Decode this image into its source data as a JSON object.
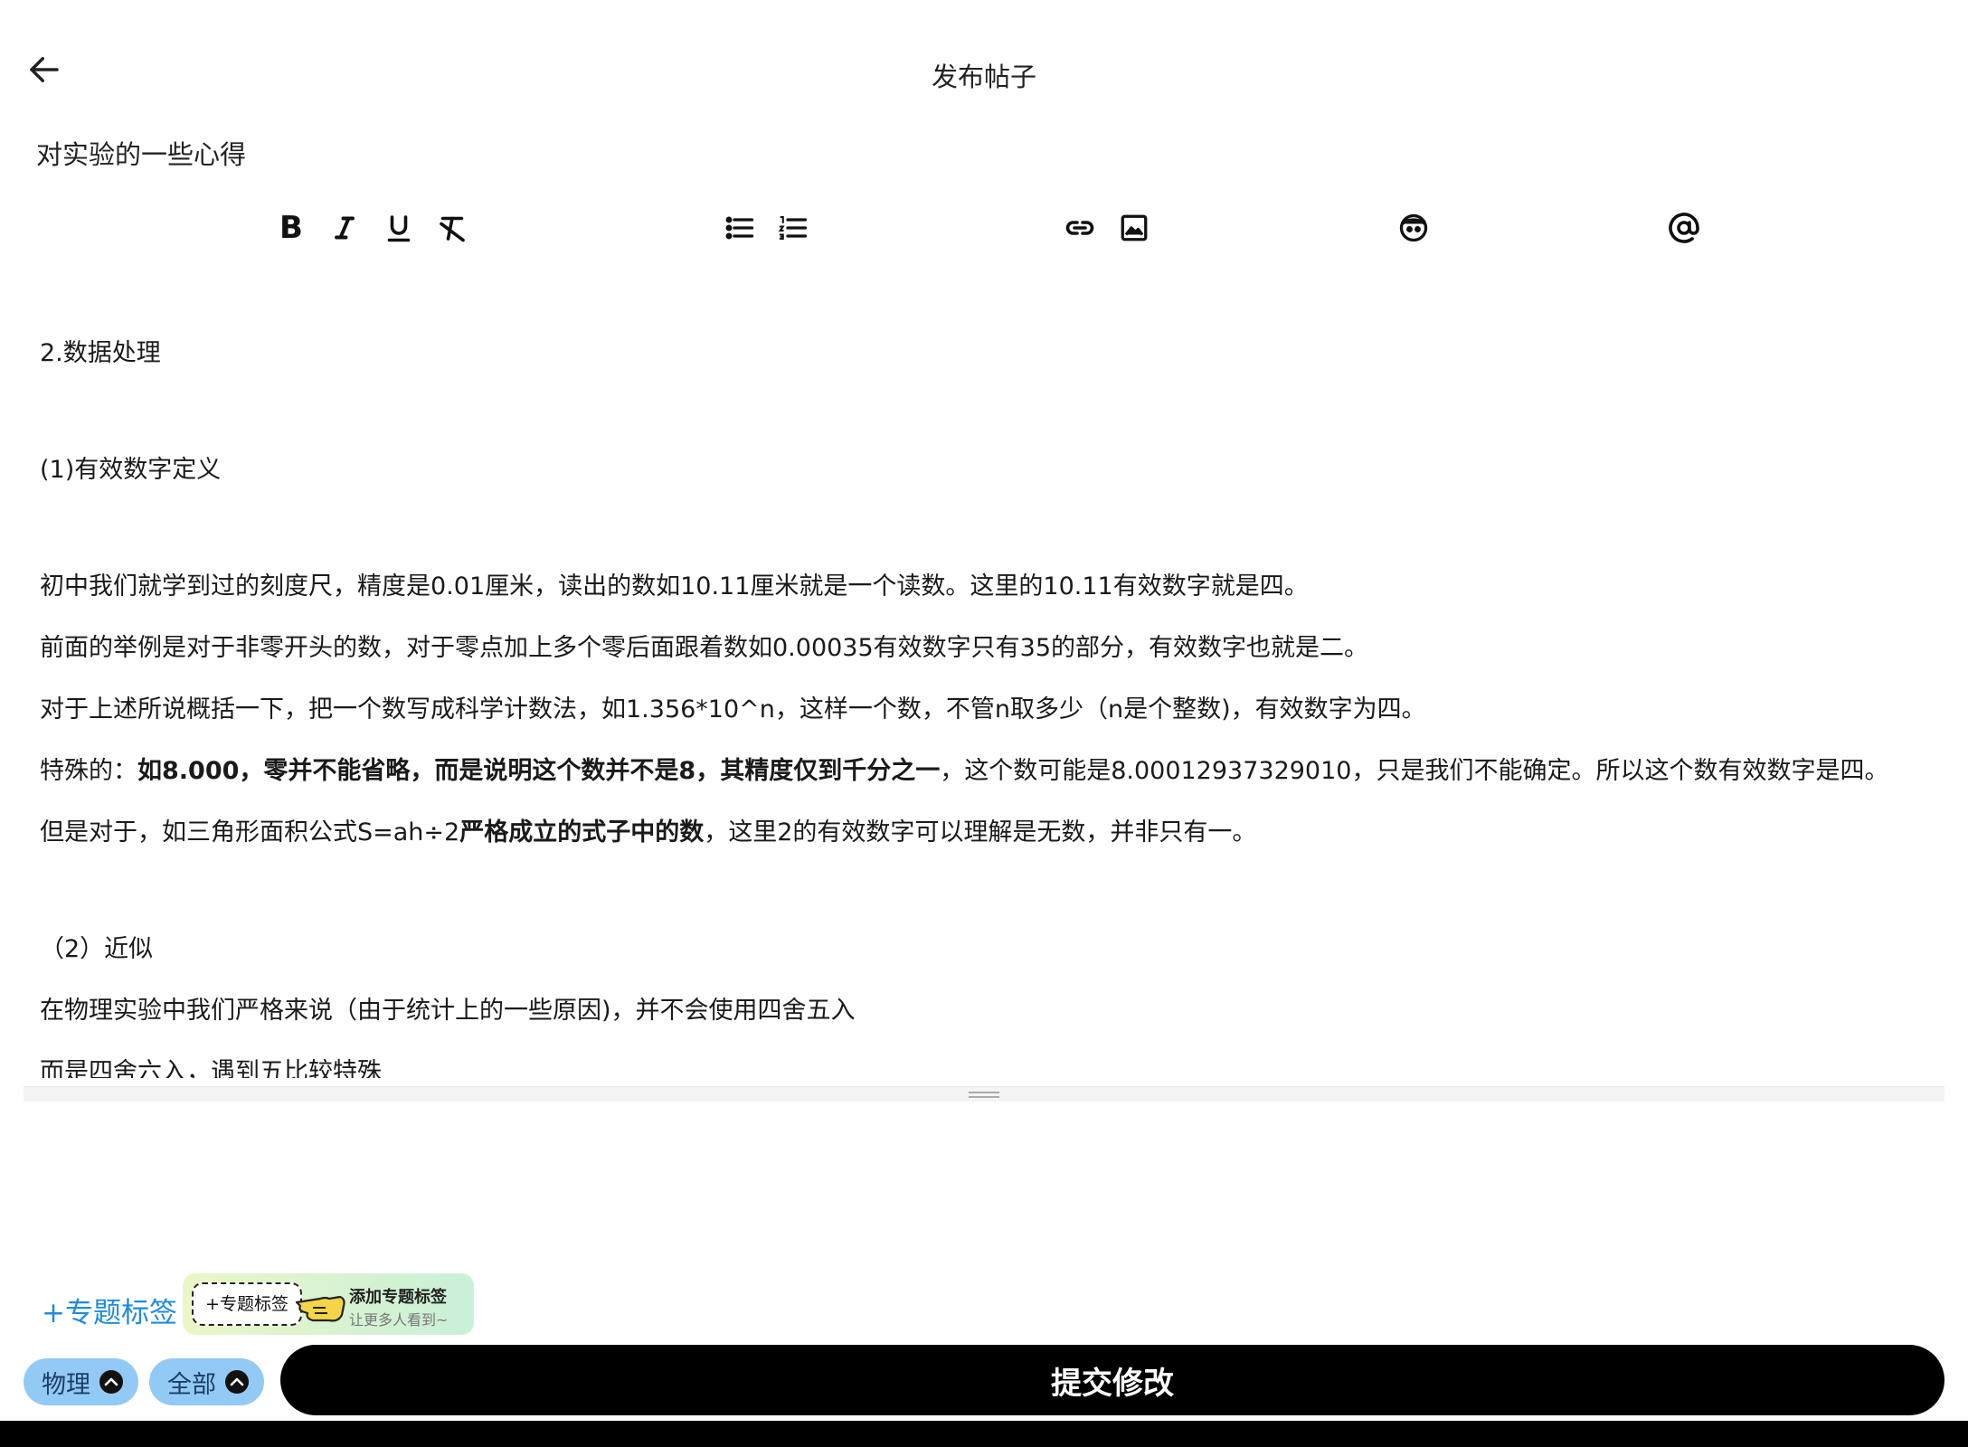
{
  "header": {
    "title": "发布帖子"
  },
  "post": {
    "title": "对实验的一些心得"
  },
  "toolbar": {
    "bold_label": "B",
    "icons": [
      "arrow-left-icon",
      "bold-icon",
      "italic-icon",
      "underline-icon",
      "clear-format-icon",
      "bullet-list-icon",
      "numbered-list-icon",
      "link-icon",
      "image-icon",
      "emoji-icon",
      "at-mention-icon"
    ]
  },
  "editor": {
    "p1": "2.数据处理",
    "p2": "(1)有效数字定义",
    "p3": "初中我们就学到过的刻度尺，精度是0.01厘米，读出的数如10.11厘米就是一个读数。这里的10.11有效数字就是四。",
    "p4": "前面的举例是对于非零开头的数，对于零点加上多个零后面跟着数如0.00035有效数字只有35的部分，有效数字也就是二。",
    "p5": "对于上述所说概括一下，把一个数写成科学计数法，如1.356*10^n，这样一个数，不管n取多少（n是个整数)，有效数字为四。",
    "p6_a": "特殊的：",
    "p6_b": "如8.000，零并不能省略，而是说明这个数并不是8，其精度仅到千分之一",
    "p6_c": "，这个数可能是8.00012937329010，只是我们不能确定。所以这个数有效数字是四。",
    "p7_a": "但是对于，如三角形面积公式S=ah÷2",
    "p7_b": "严格成立的式子中的数",
    "p7_c": "，这里2的有效数字可以理解是无数，并非只有一。",
    "p8": "（2）近似",
    "p9": "在物理实验中我们严格来说（由于统计上的一些原因)，并不会使用四舍五入",
    "p10": "而是四舍六入，遇到五比较特殊"
  },
  "topic": {
    "add_link": "+专题标签",
    "hint_chip": "+专题标签",
    "hint_title": "添加专题标签",
    "hint_sub": "让更多人看到~"
  },
  "footer": {
    "subject_pill": "物理",
    "scope_pill": "全部",
    "submit_label": "提交修改"
  },
  "colors": {
    "accent_link": "#1f8be0",
    "pill_bg": "#93c9f5",
    "submit_bg": "#000000"
  }
}
